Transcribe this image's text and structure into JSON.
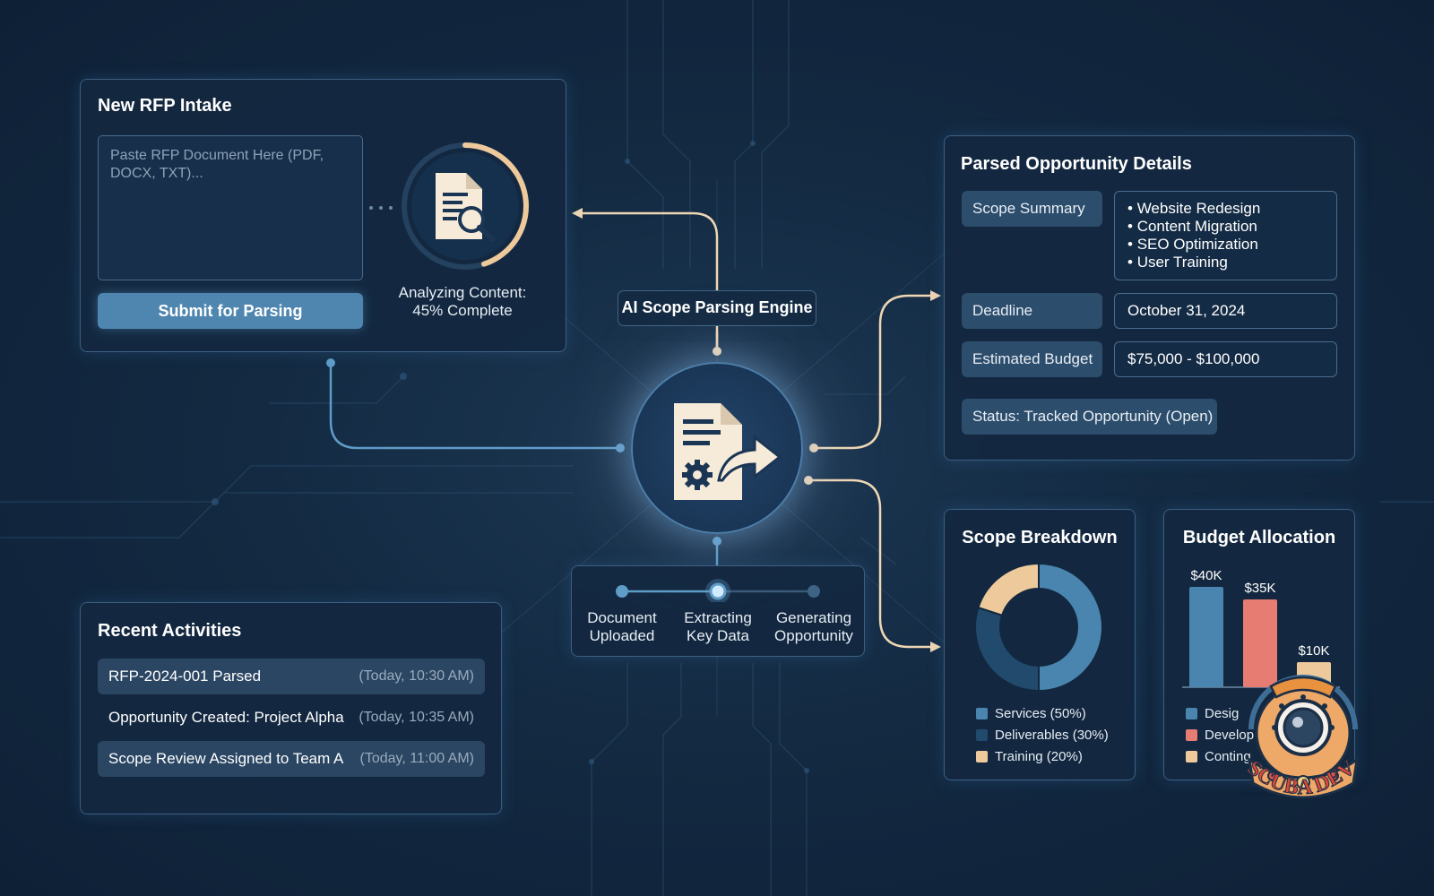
{
  "intake": {
    "title": "New RFP Intake",
    "placeholder": "Paste RFP Document Here (PDF, DOCX, TXT)...",
    "submit_label": "Submit for Parsing",
    "progress_line1": "Analyzing Content:",
    "progress_line2": "45% Complete",
    "progress_fraction": 0.45
  },
  "engine": {
    "label": "AI Scope Parsing Engine",
    "steps": [
      {
        "line1": "Document",
        "line2": "Uploaded",
        "state": "done"
      },
      {
        "line1": "Extracting",
        "line2": "Key Data",
        "state": "active"
      },
      {
        "line1": "Generating",
        "line2": "Opportunity",
        "state": "pending"
      }
    ]
  },
  "details": {
    "title": "Parsed Opportunity Details",
    "scope_key": "Scope Summary",
    "scope_items": [
      "Website Redesign",
      "Content Migration",
      "SEO Optimization",
      "User Training"
    ],
    "deadline_key": "Deadline",
    "deadline_value": "October 31, 2024",
    "budget_key": "Estimated Budget",
    "budget_value": "$75,000 - $100,000",
    "status": "Status: Tracked Opportunity (Open)"
  },
  "activities": {
    "title": "Recent Activities",
    "items": [
      {
        "text": "RFP-2024-001 Parsed",
        "time": "(Today, 10:30 AM)"
      },
      {
        "text": "Opportunity Created: Project Alpha",
        "time": "(Today, 10:35 AM)"
      },
      {
        "text": "Scope Review Assigned to Team A",
        "time": "(Today, 11:00 AM)"
      }
    ]
  },
  "chart_data": [
    {
      "type": "pie",
      "title": "Scope Breakdown",
      "categories": [
        "Services (50%)",
        "Deliverables (30%)",
        "Training (20%)"
      ],
      "values": [
        50,
        30,
        20
      ],
      "colors": [
        "#4a85b0",
        "#214a6c",
        "#eec99c"
      ],
      "legend": "bottom"
    },
    {
      "type": "bar",
      "title": "Budget Allocation",
      "categories": [
        "Design",
        "Development",
        "Contingency"
      ],
      "legend_labels": [
        "Desig",
        "Develop",
        "Conting"
      ],
      "values": [
        40,
        35,
        10
      ],
      "data_labels": [
        "$40K",
        "$35K",
        "$10K"
      ],
      "colors": [
        "#4a85b0",
        "#e67c72",
        "#eec99c"
      ],
      "ylim": [
        0,
        40
      ],
      "legend": "bottom"
    }
  ],
  "watermark": {
    "text": "SCUBA DEV"
  }
}
